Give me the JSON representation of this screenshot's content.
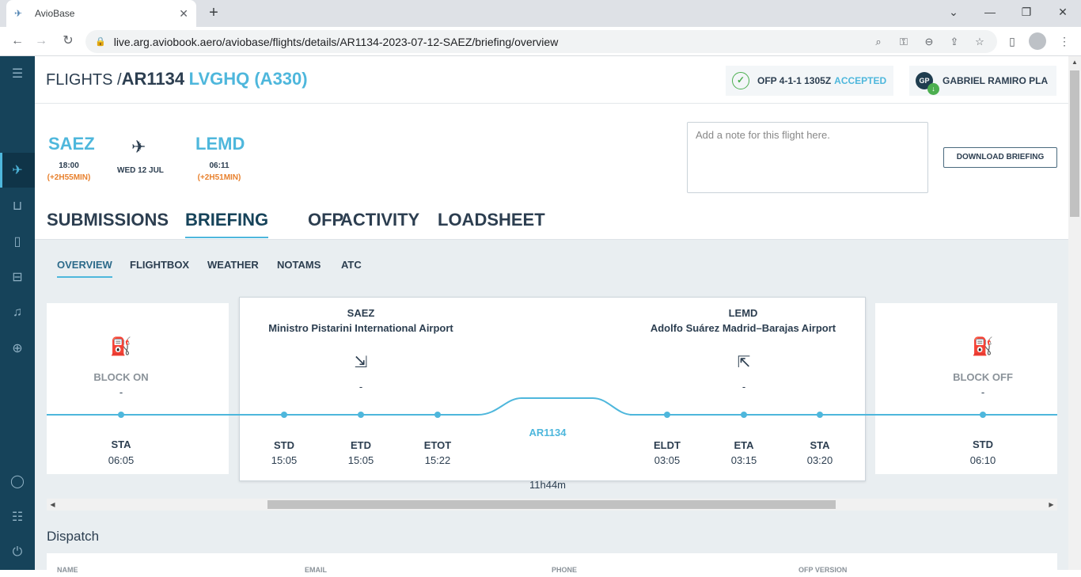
{
  "browser": {
    "tab_title": "AvioBase",
    "url": "live.arg.aviobook.aero/aviobase/flights/details/AR1134-2023-07-12-SAEZ/briefing/overview"
  },
  "header": {
    "breadcrumb_prefix": "FLIGHTS /",
    "flight_number": "AR1134",
    "aircraft": "LVGHQ (A330)",
    "ofp_label": "OFP 4-1-1 1305Z",
    "ofp_status": "ACCEPTED",
    "user_initials": "GP",
    "user_name": "GABRIEL RAMIRO PLA"
  },
  "flight": {
    "departure": {
      "code": "SAEZ",
      "time": "18:00",
      "delay": "(+2H55MIN)"
    },
    "date": "WED 12 JUL",
    "arrival": {
      "code": "LEMD",
      "time": "06:11",
      "delay": "(+2H51MIN)"
    },
    "note_placeholder": "Add a note for this flight here.",
    "download_label": "DOWNLOAD BRIEFING"
  },
  "main_tabs": [
    "SUBMISSIONS",
    "BRIEFING",
    "OFP",
    "ACTIVITY",
    "LOADSHEET"
  ],
  "sub_tabs": [
    "OVERVIEW",
    "FLIGHTBOX",
    "WEATHER",
    "NOTAMS",
    "ATC"
  ],
  "timeline": {
    "left_card": {
      "label": "BLOCK ON",
      "value": "-",
      "event": "STA",
      "time": "06:05"
    },
    "right_card": {
      "label": "BLOCK OFF",
      "value": "-",
      "event": "STD",
      "time": "06:10"
    },
    "origin": {
      "code": "SAEZ",
      "name": "Ministro Pistarini International Airport",
      "value": "-"
    },
    "destination": {
      "code": "LEMD",
      "name": "Adolfo Suárez Madrid–Barajas Airport",
      "value": "-"
    },
    "flight_label": "AR1134",
    "duration": "11h44m",
    "events": [
      {
        "label": "STD",
        "time": "15:05"
      },
      {
        "label": "ETD",
        "time": "15:05"
      },
      {
        "label": "ETOT",
        "time": "15:22"
      },
      {
        "label": "ELDT",
        "time": "03:05"
      },
      {
        "label": "ETA",
        "time": "03:15"
      },
      {
        "label": "STA",
        "time": "03:20"
      }
    ]
  },
  "dispatch": {
    "title": "Dispatch",
    "columns": [
      "NAME",
      "EMAIL",
      "PHONE",
      "OFP VERSION"
    ]
  },
  "colors": {
    "accent": "#4eb7dc",
    "sidebar": "#16435a",
    "delay": "#e8812e",
    "accepted": "#4caf50"
  }
}
